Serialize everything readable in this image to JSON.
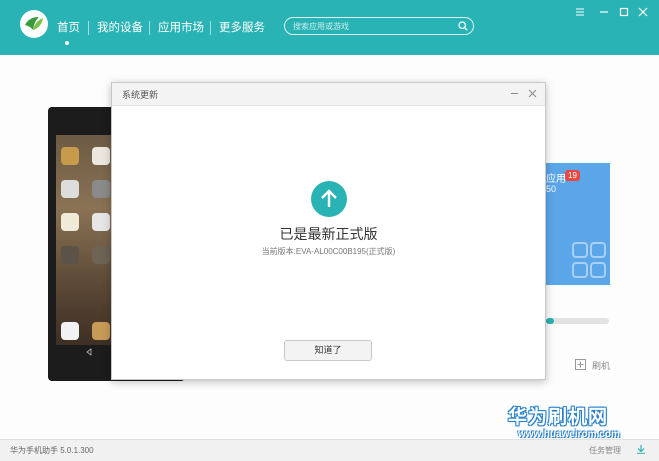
{
  "nav": {
    "items": [
      "首页",
      "我的设备",
      "应用市场",
      "更多服务"
    ],
    "active_index": 0
  },
  "search": {
    "placeholder": "搜索应用或游戏"
  },
  "window_controls": {
    "icons": [
      "app-menu-icon",
      "minimize-icon",
      "maximize-icon",
      "close-icon"
    ]
  },
  "dialog": {
    "title": "系统更新",
    "message": "已是最新正式版",
    "version": "当前版本:EVA-AL00C00B195(正式版)",
    "ok_label": "知道了"
  },
  "card": {
    "title_fragment": "应用",
    "badge": "19",
    "number_fragment": "50"
  },
  "flash": {
    "label": "刷机"
  },
  "status_bar": {
    "version": "华为手机助手 5.0.1.300",
    "task_label": "任务管理"
  },
  "watermark": {
    "brand": "华为刷机网",
    "url": "www.huaweirom.com"
  },
  "colors": {
    "brand_teal": "#2ab3b5",
    "card_blue": "#5ba6e9",
    "badge_red": "#e84a43"
  },
  "progress": {
    "fraction": 0.12
  }
}
